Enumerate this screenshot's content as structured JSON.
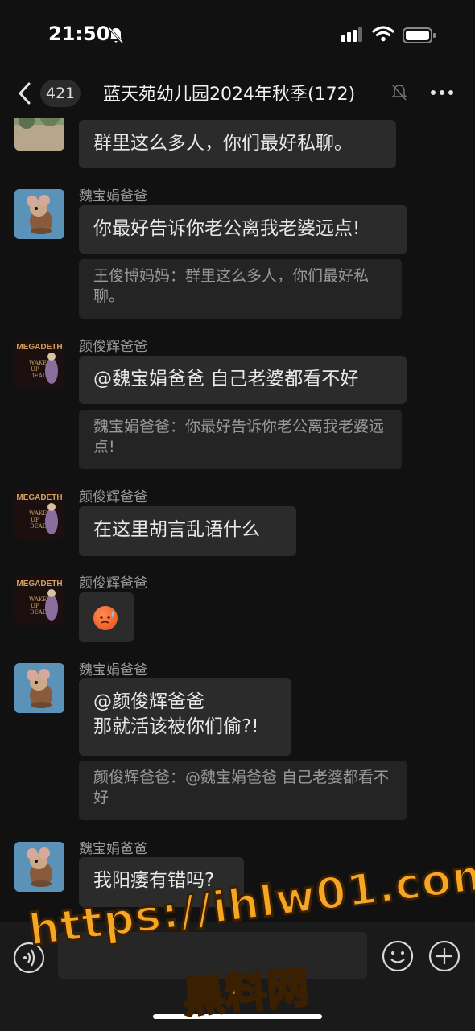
{
  "status_bar": {
    "time": "21:50"
  },
  "header": {
    "unread_count": "421",
    "group_title": "蓝天苑幼儿园2024年秋季",
    "member_count": "(172)"
  },
  "messages": [
    {
      "sender": "",
      "avatar": "landscape-avatar",
      "text": "群里这么多人，你们最好私聊。",
      "quote": ""
    },
    {
      "sender": "魏宝娟爸爸",
      "avatar": "mouse-avatar",
      "text": "你最好告诉你老公离我老婆远点!",
      "quote": "王俊博妈妈：群里这么多人，你们最好私聊。"
    },
    {
      "sender": "颜俊辉爸爸",
      "avatar": "megadeth-avatar",
      "text": "@魏宝娟爸爸 自己老婆都看不好",
      "quote": "魏宝娟爸爸：你最好告诉你老公离我老婆远点!"
    },
    {
      "sender": "颜俊辉爸爸",
      "avatar": "megadeth-avatar",
      "text": "在这里胡言乱语什么",
      "quote": ""
    },
    {
      "sender": "颜俊辉爸爸",
      "avatar": "megadeth-avatar",
      "text": "",
      "emoji": "sweat-face-emoji",
      "quote": ""
    },
    {
      "sender": "魏宝娟爸爸",
      "avatar": "mouse-avatar",
      "text_line1": "@颜俊辉爸爸",
      "text_line2": "那就活该被你们偷?!",
      "quote": "颜俊辉爸爸：@魏宝娟爸爸 自己老婆都看不好"
    },
    {
      "sender": "魏宝娟爸爸",
      "avatar": "mouse-avatar",
      "text": "我阳痿有错吗?",
      "quote": ""
    }
  ],
  "album_text": {
    "megadeth_logo": "MEGADETH",
    "megadeth_sub": "WAKE UP DEAD"
  },
  "watermark": {
    "url": "https://ihlw01.com",
    "site": "黑料网"
  },
  "colors": {
    "background": "#111111",
    "bubble": "#2b2b2b",
    "quote": "#242424",
    "watermark": "#f5a623"
  }
}
